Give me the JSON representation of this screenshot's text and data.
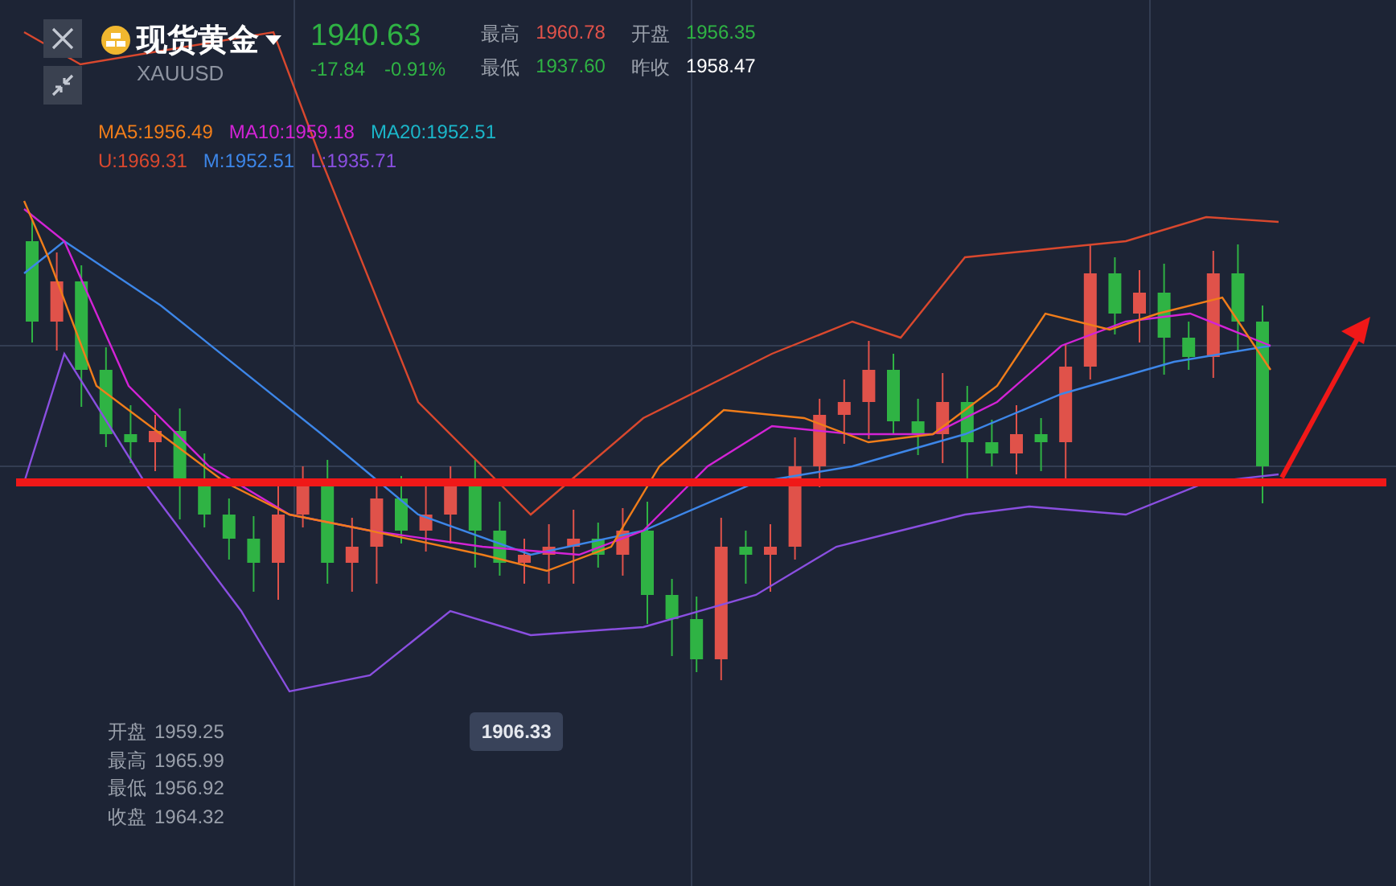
{
  "header": {
    "name": "现货黄金",
    "symbol": "XAUUSD",
    "price": "1940.63",
    "change": "-17.84",
    "change_percent": "-0.91%",
    "stats": [
      {
        "label": "最高",
        "value": "1960.78",
        "color": "#e0524a"
      },
      {
        "label": "开盘",
        "value": "1956.35",
        "color": "#2fb344"
      },
      {
        "label": "最低",
        "value": "1937.60",
        "color": "#2fb344"
      },
      {
        "label": "昨收",
        "value": "1958.47",
        "color": "#ffffff"
      }
    ]
  },
  "indicators": [
    [
      {
        "text": "MA5:1956.49",
        "color": "#f07d1a"
      },
      {
        "text": "MA10:1959.18",
        "color": "#d323d6"
      },
      {
        "text": "MA20:1952.51",
        "color": "#1bb6c9"
      }
    ],
    [
      {
        "text": "U:1969.31",
        "color": "#d9482e"
      },
      {
        "text": "M:1952.51",
        "color": "#3d86e8"
      },
      {
        "text": "L:1935.71",
        "color": "#8a4fe0"
      }
    ]
  ],
  "low_marker": "1906.33",
  "ohlc": [
    {
      "label": "开盘",
      "value": "1959.25"
    },
    {
      "label": "最高",
      "value": "1965.99"
    },
    {
      "label": "最低",
      "value": "1956.92"
    },
    {
      "label": "收盘",
      "value": "1964.32"
    }
  ]
}
